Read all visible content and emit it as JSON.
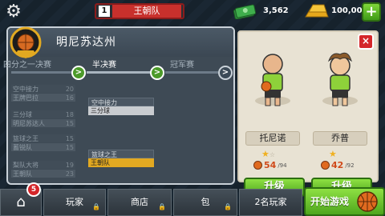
{
  "topbar": {
    "rank_number": "1",
    "rank_team": "王朝队",
    "cash_value": "3,562",
    "gold_value": "100,005",
    "plus_label": "+"
  },
  "panel": {
    "title": "明尼苏达州",
    "stages": [
      "四分之一决赛",
      "半决赛",
      "冠军赛"
    ],
    "stage_arrow": ">",
    "quarterfinals": [
      {
        "team": "空中接力",
        "score": "20",
        "style": "dark"
      },
      {
        "team": "王牌巴拉",
        "score": "16",
        "style": "normal"
      },
      {
        "team": "三分球",
        "score": "18",
        "style": "dark"
      },
      {
        "team": "明尼苏达人",
        "score": "15",
        "style": "normal"
      },
      {
        "team": "篮球之王",
        "score": "15",
        "style": "dark"
      },
      {
        "team": "蓄锐队",
        "score": "15",
        "style": "normal"
      },
      {
        "team": "梨队大将",
        "score": "19",
        "style": "dark"
      },
      {
        "team": "王朝队",
        "score": "23",
        "style": "normal"
      }
    ],
    "semifinals": [
      {
        "top": "空中接力",
        "bottom": "三分球",
        "highlight": false
      },
      {
        "top": "篮球之王",
        "bottom": "王朝队",
        "highlight": true
      }
    ]
  },
  "players": [
    {
      "name": "托尼诺",
      "stars_filled": "★",
      "stars_empty": "☆",
      "rating": "54",
      "rating_max": "/94",
      "upgrade_label": "升级"
    },
    {
      "name": "乔普",
      "stars_filled": "★",
      "stars_empty": "",
      "rating": "42",
      "rating_max": "/92",
      "upgrade_label": "升级"
    }
  ],
  "close_label": "×",
  "bottombar": {
    "notification_count": "5",
    "tabs": [
      "玩家",
      "商店",
      "包",
      "2名玩家"
    ],
    "start_label": "开始游戏"
  },
  "colors": {
    "accent_green": "#4ea61d",
    "highlight_gold": "#e2a921",
    "alert_red": "#d4262a"
  }
}
